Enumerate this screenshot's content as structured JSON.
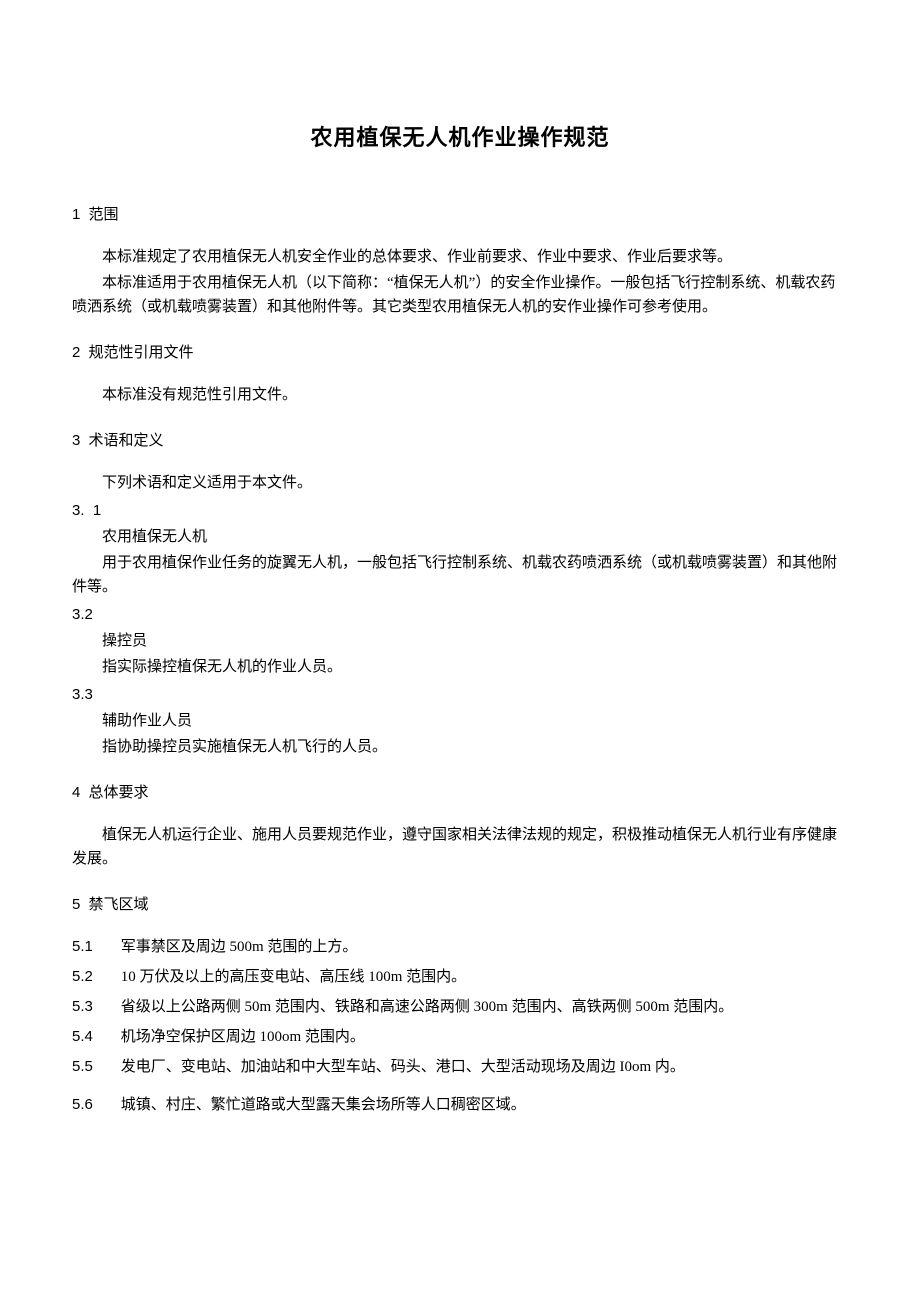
{
  "title": "农用植保无人机作业操作规范",
  "s1": {
    "heading_num": "1",
    "heading_text": "范围",
    "p1": "本标准规定了农用植保无人机安全作业的总体要求、作业前要求、作业中要求、作业后要求等。",
    "p2": "本标准适用于农用植保无人机（以下简称：“植保无人机”）的安全作业操作。一般包括飞行控制系统、机载农药喷洒系统（或机载喷雾装置）和其他附件等。其它类型农用植保无人机的安作业操作可参考使用。"
  },
  "s2": {
    "heading_num": "2",
    "heading_text": "规范性引用文件",
    "p1": "本标准没有规范性引用文件。"
  },
  "s3": {
    "heading_num": "3",
    "heading_text": "术语和定义",
    "intro": "下列术语和定义适用于本文件。",
    "t1": {
      "num": "3.  1",
      "name": "农用植保无人机",
      "def": "用于农用植保作业任务的旋翼无人机，一般包括飞行控制系统、机载农药喷洒系统（或机载喷雾装置）和其他附件等。"
    },
    "t2": {
      "num": "3.2",
      "name": "操控员",
      "def": "指实际操控植保无人机的作业人员。"
    },
    "t3": {
      "num": "3.3",
      "name": "辅助作业人员",
      "def": "指协助操控员实施植保无人机飞行的人员。"
    }
  },
  "s4": {
    "heading_num": "4",
    "heading_text": "总体要求",
    "p1": "植保无人机运行企业、施用人员要规范作业，遵守国家相关法律法规的规定，积极推动植保无人机行业有序健康发展。"
  },
  "s5": {
    "heading_num": "5",
    "heading_text": "禁飞区域",
    "items": {
      "i1": {
        "num": "5.1",
        "text": "军事禁区及周边 500m 范围的上方。"
      },
      "i2": {
        "num": "5.2",
        "text": "10 万伏及以上的高压变电站、高压线 100m 范围内。"
      },
      "i3": {
        "num": "5.3",
        "text": "省级以上公路两侧 50m 范围内、铁路和高速公路两侧 300m 范围内、高铁两侧 500m 范围内。"
      },
      "i4": {
        "num": "5.4",
        "text": "机场净空保护区周边 100om 范围内。"
      },
      "i5": {
        "num": "5.5",
        "text": "发电厂、变电站、加油站和中大型车站、码头、港口、大型活动现场及周边 I0om 内。"
      },
      "i6": {
        "num": "5.6",
        "text": "城镇、村庄、繁忙道路或大型露天集会场所等人口稠密区域。"
      }
    }
  }
}
